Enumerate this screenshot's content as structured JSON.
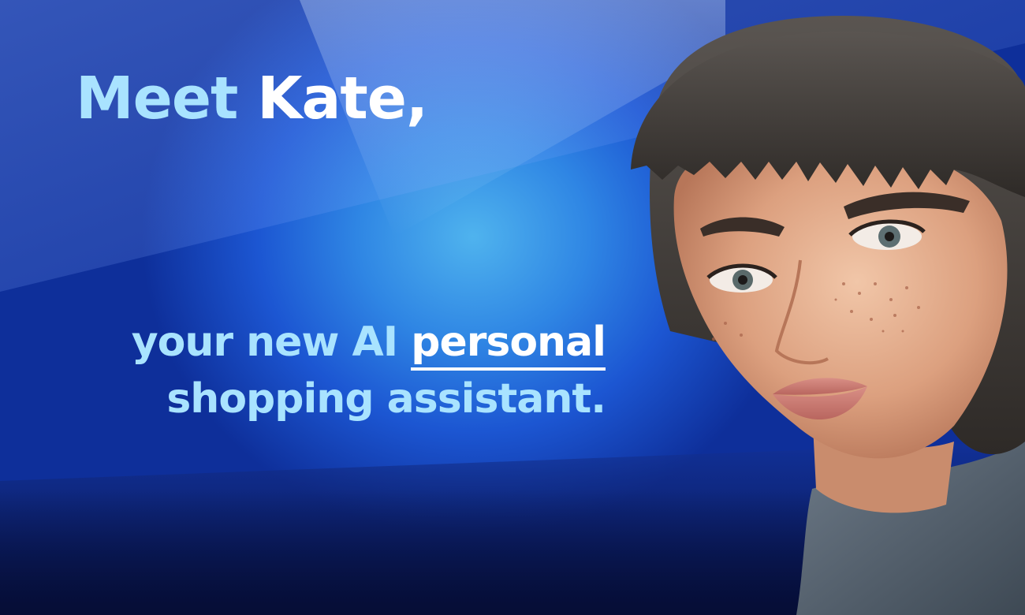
{
  "banner": {
    "headline": {
      "prefix": "Meet ",
      "name": "Kate,"
    },
    "tagline": {
      "line1_prefix": "your new AI ",
      "line1_highlight": "personal",
      "line2": "shopping assistant."
    }
  },
  "portrait": {
    "icon": "woman-portrait"
  },
  "colors": {
    "accent_light_blue": "#a9e3ff",
    "text_white": "#ffffff",
    "background_deep_blue": "#0e2f9a",
    "background_glow": "#4fb3ee"
  }
}
